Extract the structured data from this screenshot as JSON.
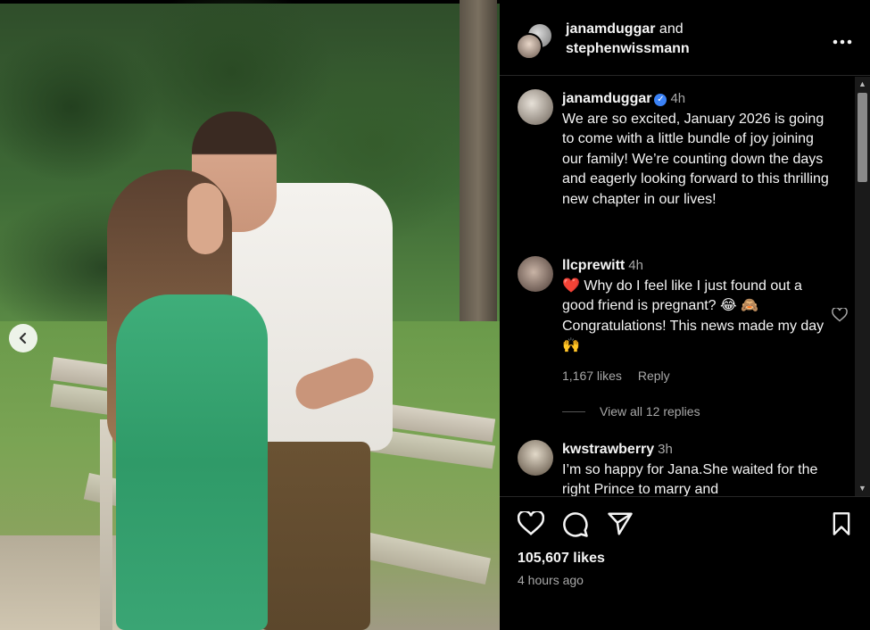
{
  "post": {
    "header": {
      "user1": "janamduggar",
      "and": "and",
      "user2": "stephenwissmann"
    },
    "caption": {
      "user": "janamduggar",
      "time": "4h",
      "text": "We are so excited, January 2026 is going to come with a little bundle of joy joining our family! We’re counting down the days and eagerly looking forward to this thrilling new chapter in our lives!"
    },
    "comments": [
      {
        "user": "llcprewitt",
        "time": "4h",
        "text": "❤️ Why do I feel like I just found out a good friend is pregnant? 😂 🙈 Congratulations! This news made my day 🙌",
        "likes": "1,167 likes",
        "reply": "Reply",
        "view_replies": "View all 12 replies"
      },
      {
        "user": "kwstrawberry",
        "time": "3h",
        "text": "I’m so happy for Jana.She waited for the right Prince to marry and"
      }
    ],
    "likes": "105,607 likes",
    "posted_ago": "4 hours ago"
  },
  "icons": {
    "prev": "chevron-left-icon",
    "more": "more-options-icon",
    "like": "heart-icon",
    "comment": "comment-icon",
    "share": "send-icon",
    "save": "bookmark-icon"
  },
  "colors": {
    "background": "#000000",
    "text": "#f5f5f5",
    "secondary_text": "#a8a8a8",
    "verified": "#3b82f6"
  }
}
